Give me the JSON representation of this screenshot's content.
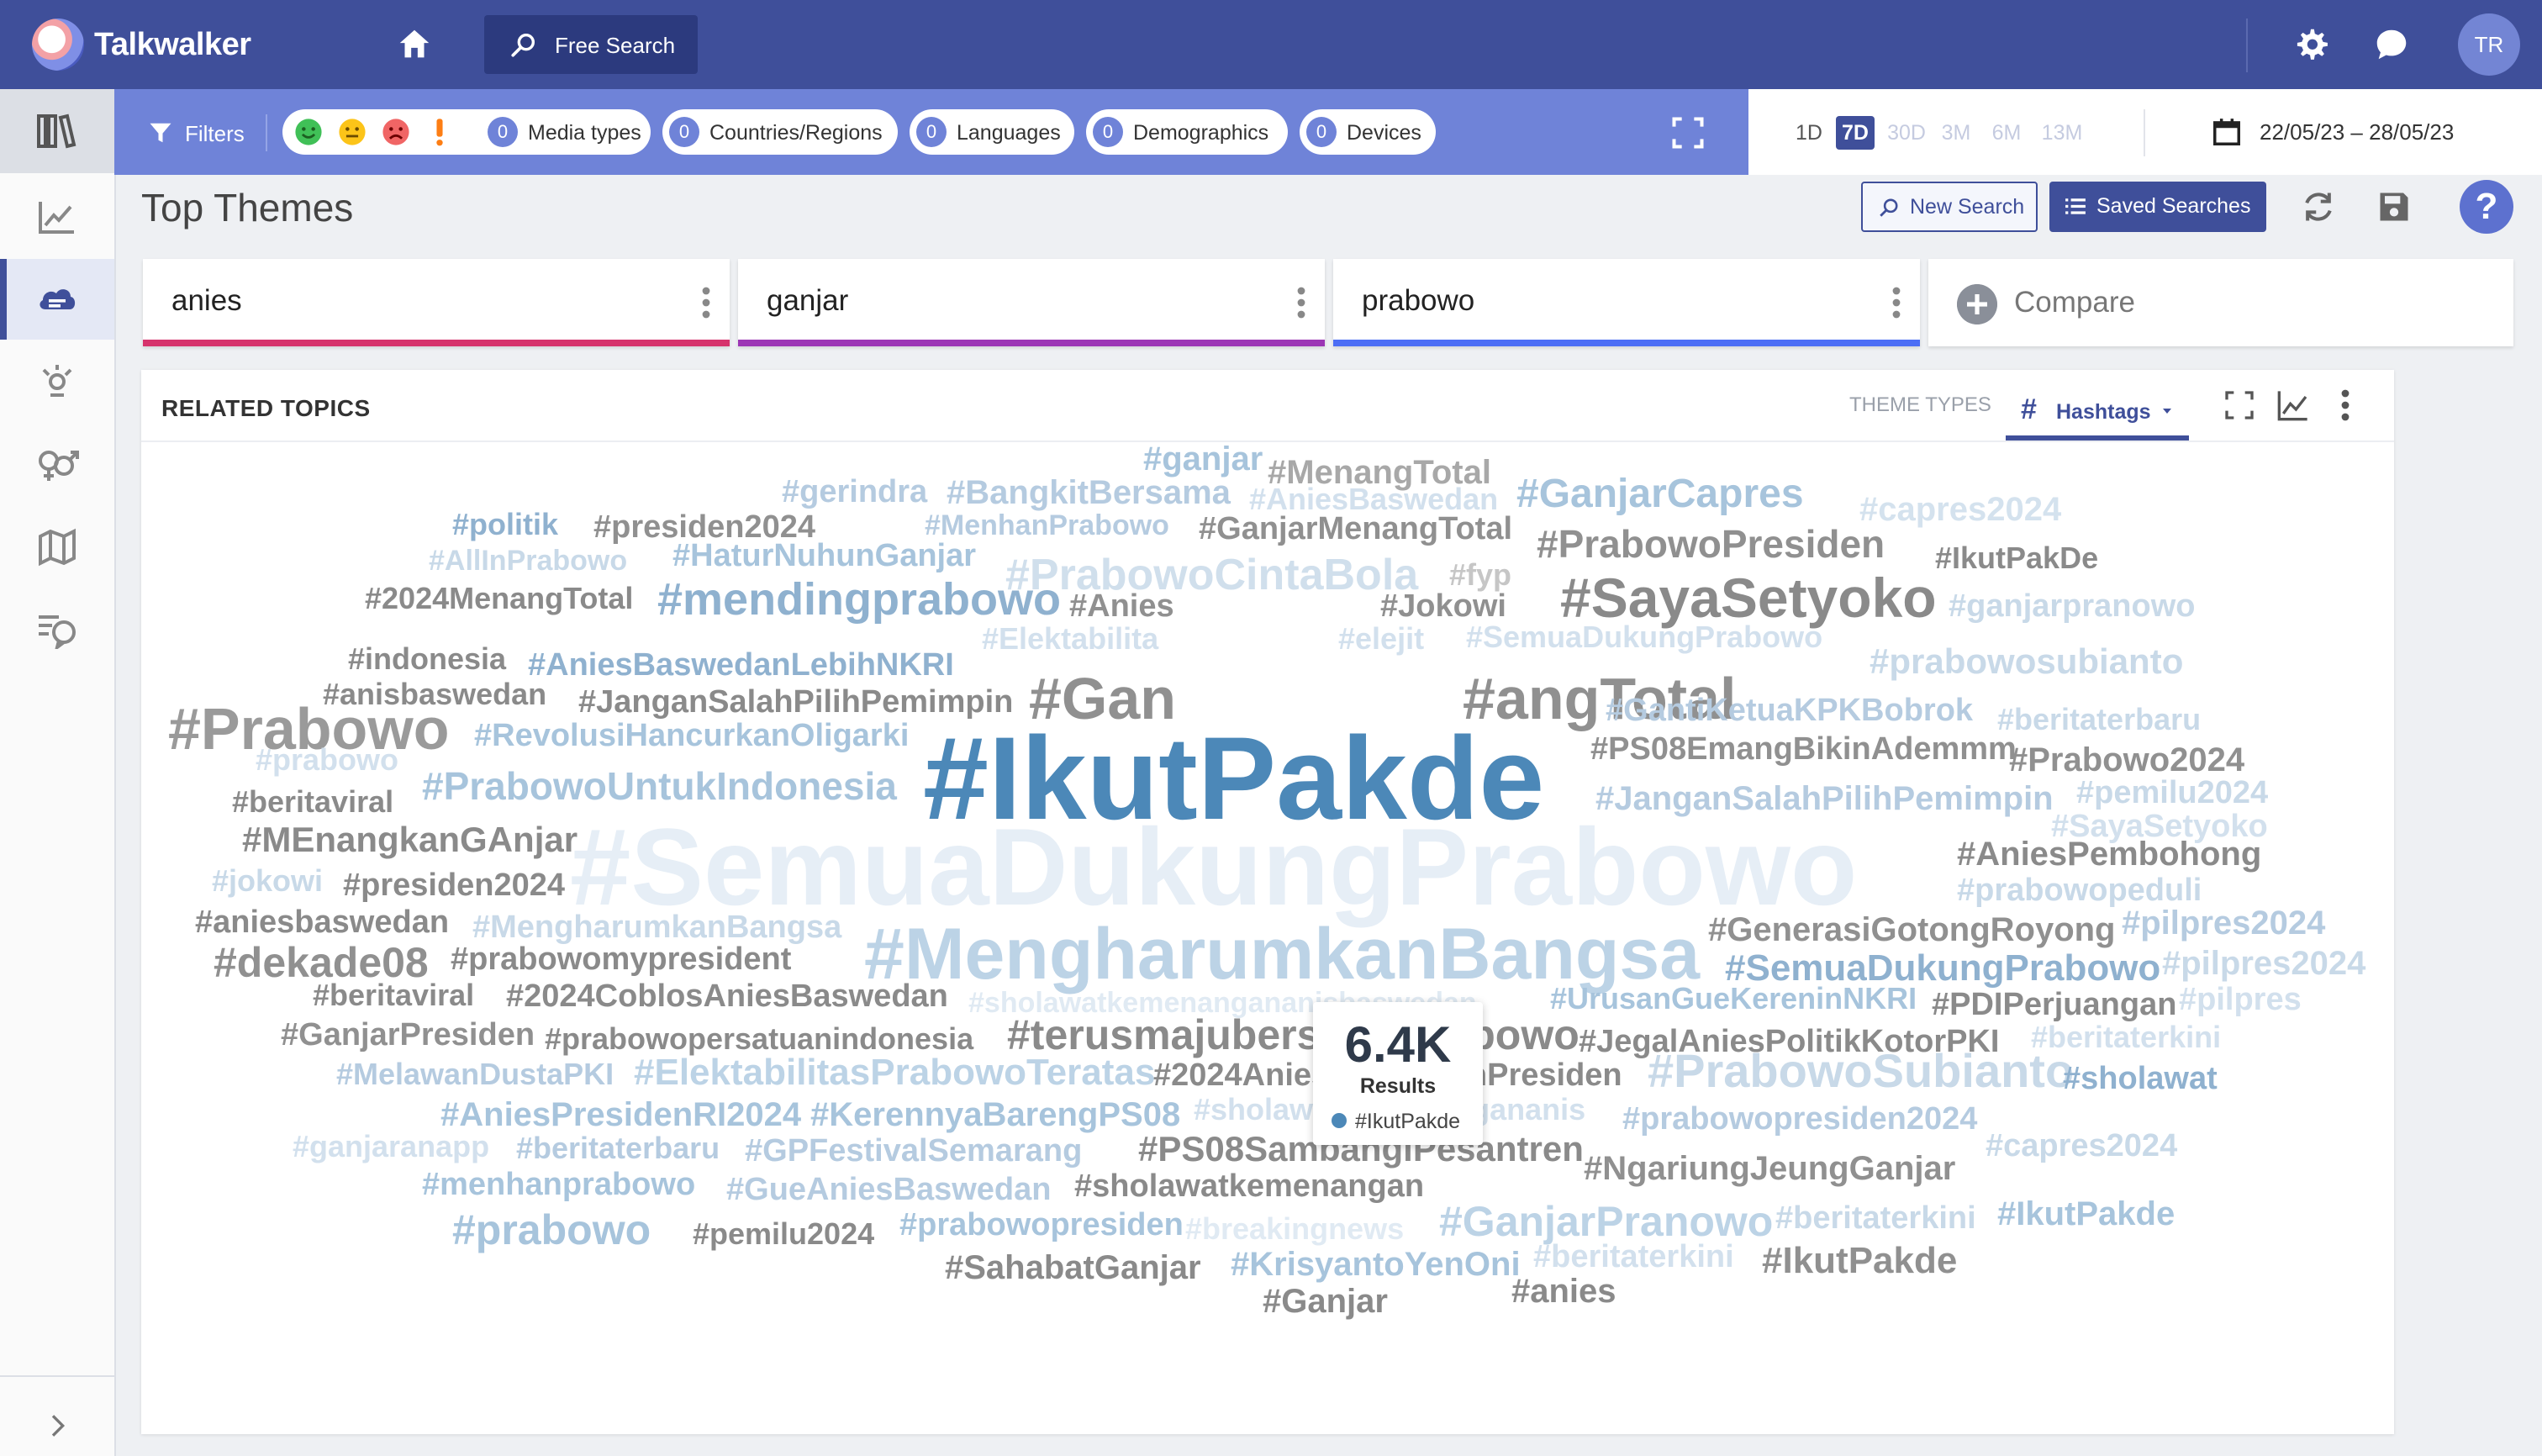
{
  "app": {
    "name": "Talkwalker",
    "free_search": "Free Search",
    "avatar": "TR"
  },
  "filters": {
    "label": "Filters",
    "items": [
      {
        "count": "0",
        "label": "Media types"
      },
      {
        "count": "0",
        "label": "Countries/Regions"
      },
      {
        "count": "0",
        "label": "Languages"
      },
      {
        "count": "0",
        "label": "Demographics"
      },
      {
        "count": "0",
        "label": "Devices"
      }
    ]
  },
  "date": {
    "ranges": [
      "1D",
      "7D",
      "30D",
      "3M",
      "6M",
      "13M"
    ],
    "selected": "7D",
    "value": "22/05/23 – 28/05/23"
  },
  "page": {
    "title": "Top Themes",
    "new_search": "New Search",
    "saved_searches": "Saved Searches",
    "help": "?"
  },
  "queries": [
    {
      "label": "anies",
      "color": "#d6336c"
    },
    {
      "label": "ganjar",
      "color": "#9c36b5"
    },
    {
      "label": "prabowo",
      "color": "#4c6ef5"
    }
  ],
  "compare_label": "Compare",
  "card": {
    "title": "RELATED TOPICS",
    "theme_types_label": "THEME TYPES",
    "hashtags_symbol": "#",
    "hashtags_label": "Hashtags"
  },
  "tooltip": {
    "value": "6.4K",
    "label": "Results",
    "series": "#IkutPakde"
  },
  "colors": {
    "brand": "#3f4f9a",
    "filter_bar": "#6f83d8",
    "cloud_blue": "#4c88b8",
    "cloud_gray": "#8a8a8a",
    "cloud_lightblue": "#bcd3e6",
    "cloud_lightgray": "#c6c6c6"
  },
  "words": [
    "#ganjar",
    "#MenangTotal",
    "#gerindra",
    "#BangkitBersama",
    "#AniesBaswedan",
    "#GanjarCapres",
    "#capres2024",
    "#politik",
    "#presiden2024",
    "#MenhanPrabowo",
    "#GanjarMenangTotal",
    "#PrabowoPresiden",
    "#AllInPrabowo",
    "#HaturNuhunGanjar",
    "#PrabowoCintaBola",
    "#fyp",
    "#IkutPakDe",
    "#2024MenangTotal",
    "#mendingprabowo",
    "#Anies",
    "#Jokowi",
    "#SayaSetyoko",
    "#ganjarpranowo",
    "#Elektabilita",
    "#elejit",
    "#SemuaDukungPrabowo",
    "#indonesia",
    "#AniesBaswedanLebihNKRI",
    "#prabowosubianto",
    "#anisbaswedan",
    "#JanganSalahPilihPemimpin",
    "#Gan",
    "#angTotal",
    "#GantiKetuaKPKBobrok",
    "#beritaterbaru",
    "#Prabowo",
    "#RevolusiHancurkanOligarki",
    "#PS08EmangBikinAdemmm",
    "#Prabowo2024",
    "#prabowo",
    "#IkutPakde",
    "#PrabowoUntukIndonesia",
    "#JanganSalahPilihPemimpin",
    "#pemilu2024",
    "#beritaviral",
    "#SayaSetyoko",
    "#MEnangkanGAnjar",
    "#SemuaDukungPrabowo",
    "#AniesPembohong",
    "#jokowi",
    "#presiden2024",
    "#prabowopeduli",
    "#aniesbaswedan",
    "#MengharumkanBangsa",
    "#GenerasiGotongRoyong",
    "#pilpres2024",
    "#dekade08",
    "#prabowomypresident",
    "#MengharumkanBangsa",
    "#SemuaDukungPrabowo",
    "#pilpres2024",
    "#beritaviral",
    "#2024CoblosAniesBaswedan",
    "#sholawatkemenangananisbaswedan",
    "#UrusanGueKereninNKRI",
    "#PDIPerjuangan",
    "#pilpres",
    "#GanjarPresiden",
    "#prabowopersatuanindonesia",
    "#terusmajubersamaprabowo",
    "#JegalAniesPolitikKotorPKI",
    "#beritaterkini",
    "#MelawanDustaPKI",
    "#ElektabilitasPrabowoTeratas",
    "#2024AniesBaswedanPresiden",
    "#PrabowoSubianto",
    "#sholawat",
    "#AniesPresidenRI2024",
    "#KerennyaBarengPS08",
    "#sholawatkemenangananis",
    "#prabowopresiden2024",
    "#ganjaranapp",
    "#beritaterbaru",
    "#GPFestivalSemarang",
    "#PS08SambangiPesantren",
    "#capres2024",
    "#menhanprabowo",
    "#GueAniesBaswedan",
    "#sholawatkemenangan",
    "#NgariungJeungGanjar",
    "#prabowo",
    "#pemilu2024",
    "#prabowopresiden",
    "#breakingnews",
    "#GanjarPranowo",
    "#beritaterkini",
    "#IkutPakde",
    "#SahabatGanjar",
    "#KrisyantoYenOni",
    "#beritaterkini",
    "#IkutPakde",
    "#Ganjar",
    "#anies"
  ]
}
